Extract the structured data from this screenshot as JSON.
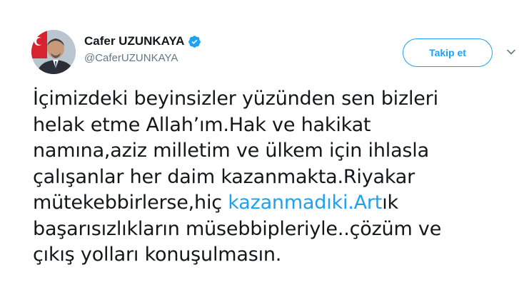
{
  "user": {
    "display_name": "Cafer UZUNKAYA",
    "handle": "@CaferUZUNKAYA",
    "verified": true
  },
  "actions": {
    "follow_label": "Takip et"
  },
  "tweet": {
    "lines": [
      {
        "text": "İçimizdeki beyinsizler yüzünden sen bizleri"
      },
      {
        "text": "helak etme Allah’ım.Hak ve hakikat"
      },
      {
        "text": "namına,aziz milletim ve ülkem için ihlasla"
      },
      {
        "text": "çalışanlar her daim kazanmakta.Riyakar"
      },
      {
        "before": "mütekebbirlerse,hiç  ",
        "link": "kazanmadıki.Art",
        "after": "ık"
      },
      {
        "text": "başarısızlıkların müsebbipleriyle..çözüm ve"
      },
      {
        "text": "çıkış yolları konuşulmasın."
      }
    ]
  },
  "colors": {
    "accent": "#1da1f2",
    "text": "#14171a",
    "secondary": "#657786"
  },
  "icons": {
    "verified": "verified-badge-icon",
    "caret": "chevron-down-icon"
  }
}
